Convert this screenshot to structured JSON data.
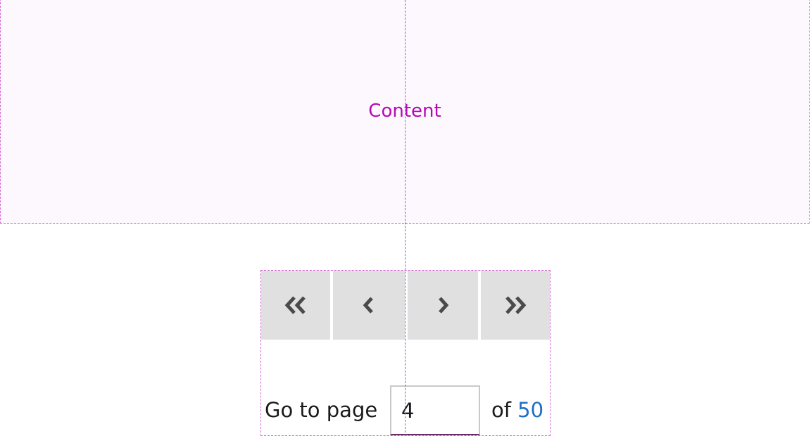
{
  "content": {
    "label": "Content"
  },
  "pagination": {
    "first_label": "«",
    "prev_label": "‹",
    "next_label": "›",
    "last_label": "»",
    "goto_label": "Go to page",
    "current_page": "4",
    "of_label": "of",
    "total_pages": "50"
  },
  "icons": {
    "first": "double-chevron-left-icon",
    "prev": "chevron-left-icon",
    "next": "chevron-right-icon",
    "last": "double-chevron-right-icon"
  },
  "colors": {
    "content_text": "#b10cb1",
    "content_border": "#d46ad4",
    "content_background": "#fdf8fd",
    "guide_line": "#6b6bdc",
    "button_background": "#e0e0e0",
    "icon": "#4a4a4a",
    "total_pages": "#1f6fc4",
    "input_underline": "#6a2a6a"
  }
}
